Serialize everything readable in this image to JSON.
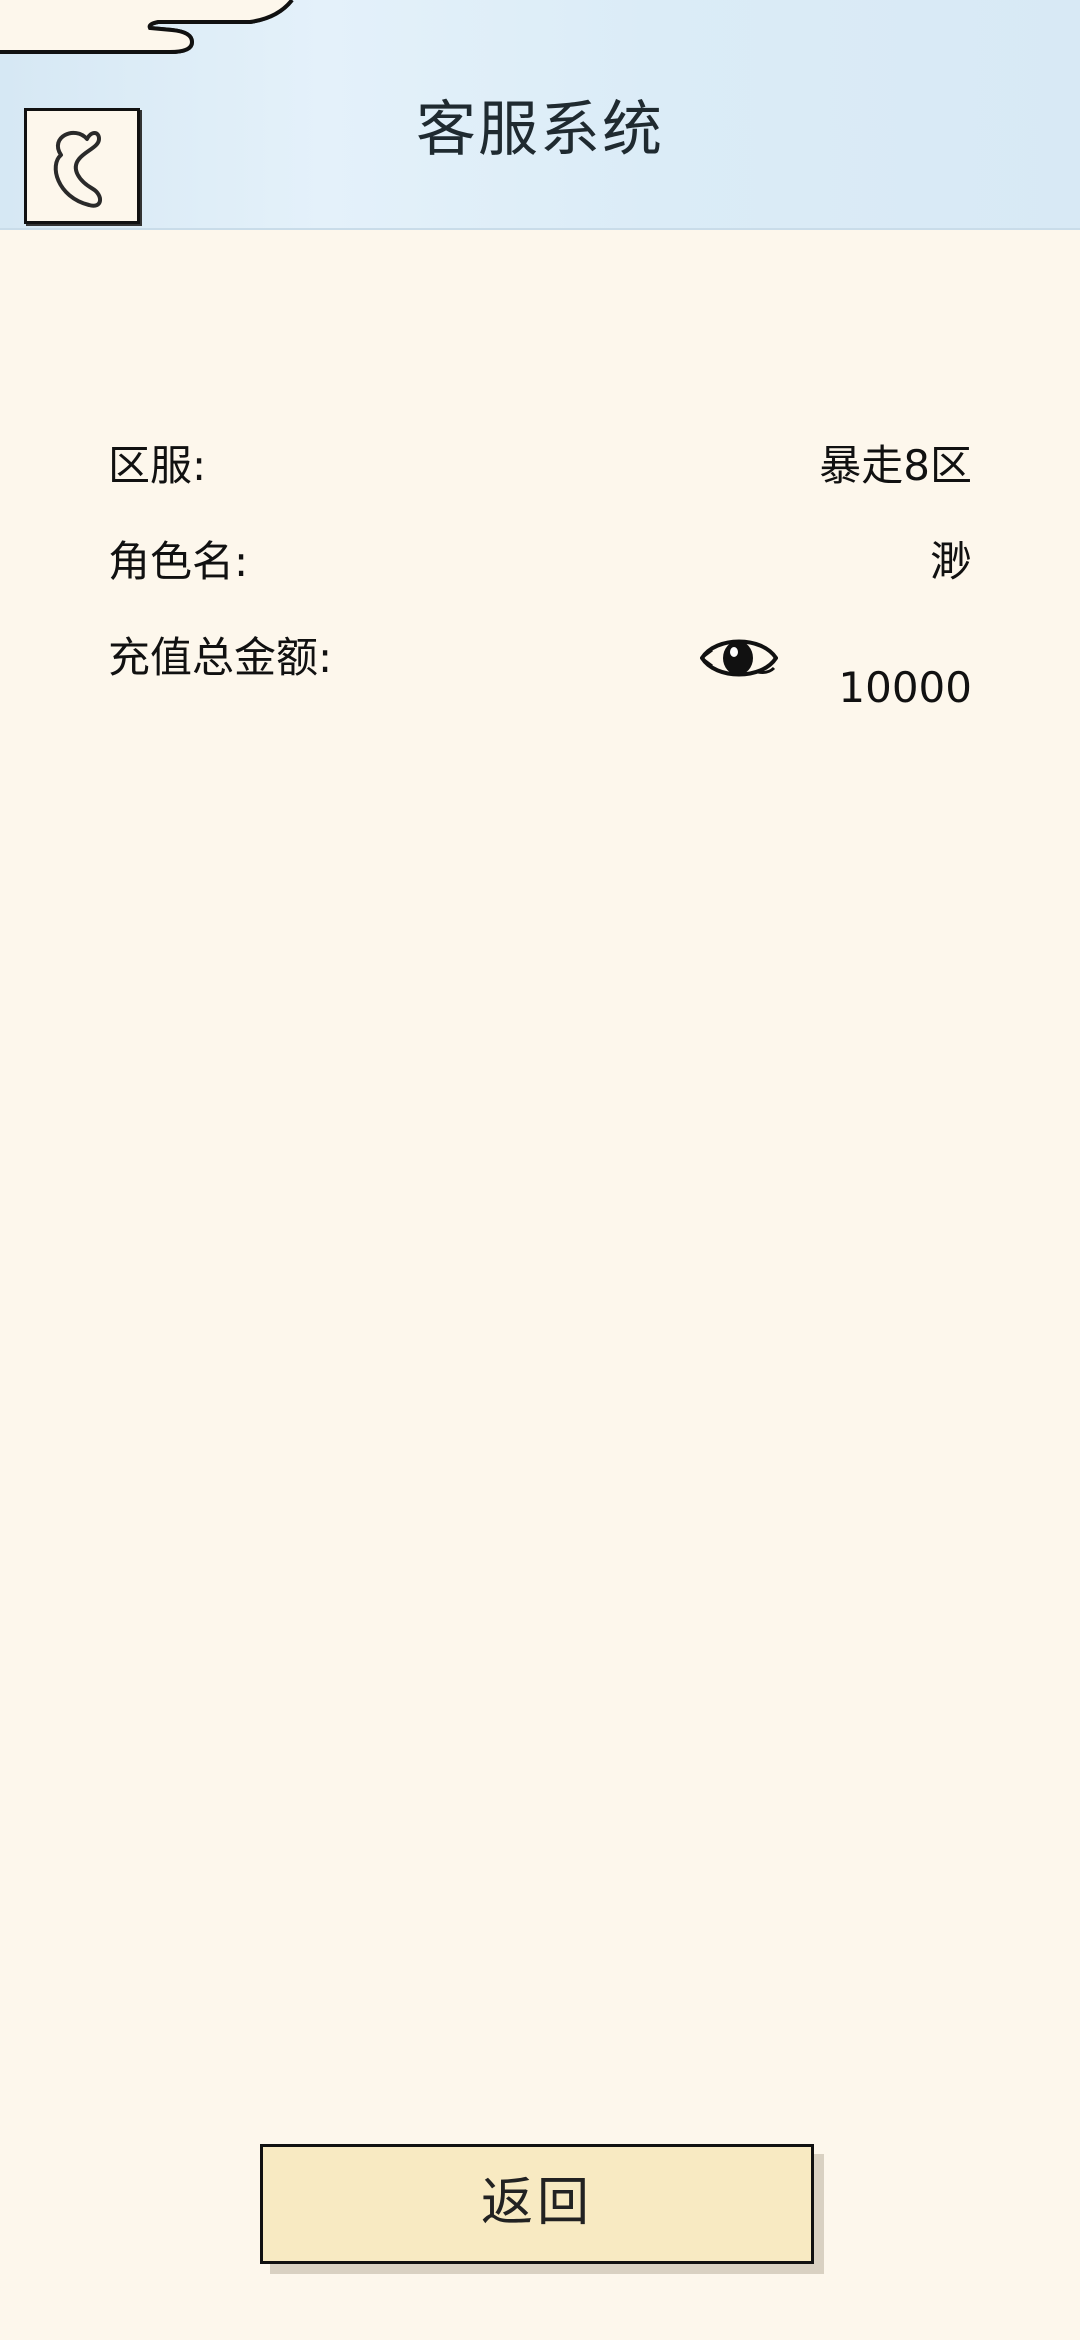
{
  "header": {
    "title": "客服系统"
  },
  "info": {
    "server_label": "区服:",
    "server_value": "暴走8区",
    "role_label": "角色名:",
    "role_value": "渺",
    "recharge_label": "充值总金额:",
    "recharge_value": "10000"
  },
  "footer": {
    "return_label": "返回"
  },
  "icons": {
    "back": "back-arrow-icon",
    "eye": "eye-icon"
  },
  "colors": {
    "background": "#fdf7ec",
    "header": "#d8eaf6",
    "button": "#f8eac2"
  }
}
